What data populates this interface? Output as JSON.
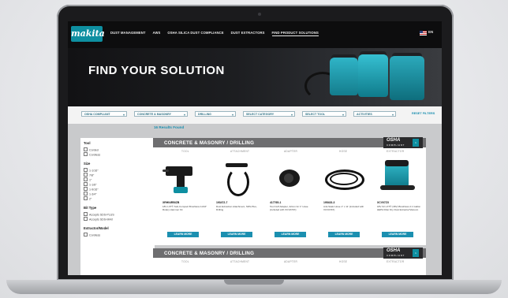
{
  "nav": {
    "logo": "makita",
    "items": [
      "DUST MANAGEMENT",
      "AWS",
      "OSHA SILICA DUST COMPLIANCE",
      "DUST EXTRACTORS",
      "FIND PRODUCT SOLUTIONS"
    ],
    "lang": "EN"
  },
  "hero": {
    "title": "FIND YOUR SOLUTION"
  },
  "filters": {
    "items": [
      "OSHA COMPLIANT",
      "CONCRETE & MASONRY",
      "DRILLING",
      "SELECT CATEGORY",
      "SELECT TOOL",
      "ACTIVITIES"
    ],
    "reset": "RESET FILTERS"
  },
  "results": {
    "count": "16 Results Found"
  },
  "sidebar": {
    "tool": {
      "heading": "Tool",
      "options": [
        "Corded",
        "Cordless"
      ]
    },
    "size": {
      "heading": "Size",
      "options": [
        "1-1/16\"",
        "7/8\"",
        "1\"",
        "1-1/8\"",
        "1-9/16\"",
        "1-3/4\"",
        "2\""
      ]
    },
    "bit": {
      "heading": "Bit Type",
      "options": [
        "Accepts SDS-PLUS",
        "Accepts SDS-MAX"
      ]
    },
    "extractor": {
      "heading": "Extractor/Model",
      "options": [
        "Cordless"
      ]
    }
  },
  "panel": {
    "title": "CONCRETE & MASONRY / DRILLING",
    "osha_title": "OSHA",
    "osha_sub": "COMPLIANT",
    "columns": [
      "TOOL",
      "ATTACHMENT",
      "ADAPTER",
      "HOSE",
      "EXTRACTOR"
    ],
    "learn_more": "LEARN MORE",
    "products": [
      {
        "code": "XRH04RB/ZB",
        "desc": "18V LXT® Sub-Compact Brushless 11/16\" Rotary Hammer Kit"
      },
      {
        "code": "193472-7",
        "desc": "Dust Extraction Attachment, SDS-Plus, Drilling"
      },
      {
        "code": "417765-1",
        "desc": "Tool Cuff Adapter, 22mm for 1\" Hose (included with XCV07ZX)"
      },
      {
        "code": "195433-3",
        "desc": "Anti-Static Hose 1\" x 11' (included with XCV07ZX)"
      },
      {
        "code": "XCV07ZX",
        "desc": "18V X2 LXT® (36V) Brushless 2.1 Gallon HEPA Filter Dry Dust Extractor/Vacuum"
      }
    ]
  },
  "panel2": {
    "title": "CONCRETE & MASONRY / DRILLING",
    "osha_title": "OSHA",
    "osha_sub": "COMPLIANT",
    "columns": [
      "TOOL",
      "ATTACHMENT",
      "ADAPTER",
      "HOSE",
      "EXTRACTOR"
    ]
  },
  "colors": {
    "accent": "#1b8fb0",
    "brand": "#0e8fa1"
  }
}
